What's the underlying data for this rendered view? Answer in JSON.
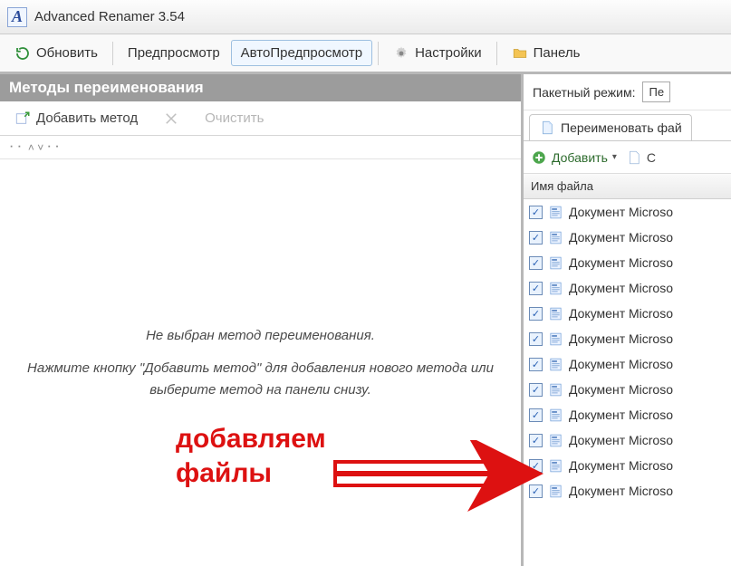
{
  "window": {
    "title": "Advanced Renamer 3.54"
  },
  "toolbar": {
    "refresh": "Обновить",
    "preview": "Предпросмотр",
    "autopreview": "АвтоПредпросмотр",
    "settings": "Настройки",
    "panel": "Панель"
  },
  "methods": {
    "title": "Методы переименования",
    "add": "Добавить метод",
    "clear": "Очистить",
    "empty_line1": "Не выбран метод переименования.",
    "empty_line2": "Нажмите кнопку \"Добавить метод\" для добавления нового метода или выберите метод на панели снизу."
  },
  "right": {
    "batch_label": "Пакетный режим:",
    "batch_value": "Пе",
    "tab_rename": "Переименовать фай",
    "add": "Добавить",
    "create_folder": "С",
    "column_name": "Имя файла"
  },
  "files": [
    {
      "name": "Документ Microso"
    },
    {
      "name": "Документ Microso"
    },
    {
      "name": "Документ Microso"
    },
    {
      "name": "Документ Microso"
    },
    {
      "name": "Документ Microso"
    },
    {
      "name": "Документ Microso"
    },
    {
      "name": "Документ Microso"
    },
    {
      "name": "Документ Microso"
    },
    {
      "name": "Документ Microso"
    },
    {
      "name": "Документ Microso"
    },
    {
      "name": "Документ Microso"
    },
    {
      "name": "Документ Microso"
    }
  ],
  "annotation": {
    "line1": "добавляем",
    "line2": "файлы"
  }
}
